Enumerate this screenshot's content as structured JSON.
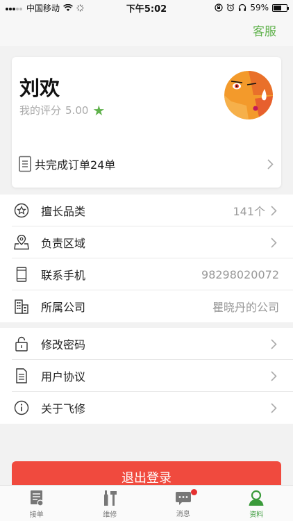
{
  "status_bar": {
    "carrier": "中国移动",
    "time": "下午5:02",
    "battery_pct": "59%",
    "battery_level": 0.59,
    "icons": [
      "signal-dots-icon",
      "wifi-icon",
      "loading-spinner-icon",
      "orientation-lock-icon",
      "alarm-icon",
      "headphones-icon",
      "battery-icon"
    ]
  },
  "header": {
    "service_label": "客服"
  },
  "profile": {
    "name": "刘欢",
    "rating_label": "我的评分",
    "rating_value": "5.00",
    "orders_summary": "共完成订单24单",
    "accent_color": "#5fb14b"
  },
  "info_menu": [
    {
      "label": "擅长品类",
      "value": "141个",
      "icon": "star-circle-icon",
      "has_chevron": true
    },
    {
      "label": "负责区域",
      "value": "",
      "icon": "map-pin-icon",
      "has_chevron": true
    },
    {
      "label": "联系手机",
      "value": "98298020072",
      "icon": "phone-icon",
      "has_chevron": false
    },
    {
      "label": "所属公司",
      "value": "瞿晓丹的公司",
      "icon": "building-icon",
      "has_chevron": false
    }
  ],
  "settings_menu": [
    {
      "label": "修改密码",
      "icon": "lock-icon"
    },
    {
      "label": "用户协议",
      "icon": "document-icon"
    },
    {
      "label": "关于飞修",
      "icon": "info-icon"
    }
  ],
  "logout_label": "退出登录",
  "logout_color": "#f04a3e",
  "tabs": [
    {
      "label": "接单",
      "icon": "order-icon",
      "active": false
    },
    {
      "label": "维修",
      "icon": "tools-icon",
      "active": false
    },
    {
      "label": "消息",
      "icon": "message-icon",
      "active": false,
      "badge": true
    },
    {
      "label": "资料",
      "icon": "profile-icon",
      "active": true
    }
  ]
}
